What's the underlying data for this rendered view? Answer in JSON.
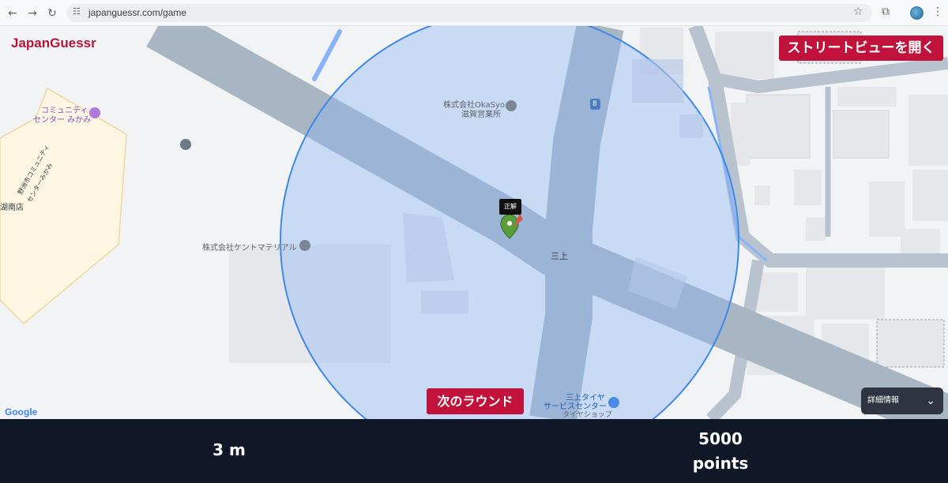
{
  "browser": {
    "url": "japanguessr.com/game",
    "icons": [
      "back-icon",
      "forward-icon",
      "reload-icon",
      "site-info-icon",
      "star-icon",
      "extensions-icon",
      "profile-avatar",
      "kebab-menu-icon"
    ]
  },
  "app": {
    "logo": "JapanGuessr",
    "streetview_button": "ストリートビューを開く",
    "next_round_button": "次のラウンド",
    "details_button": "詳細情報",
    "correct_label": "正解",
    "brand_color": "#c1123c"
  },
  "map": {
    "attribution": "Google",
    "labels": {
      "community_center_1": "コミュニティ",
      "community_center_2": "センター みかみ",
      "building_1": "野洲市コミュニティ",
      "building_2": "センターみかみ",
      "okasyo_1": "株式会社OkaSyo",
      "okasyo_2": "滋賀営業所",
      "kento": "株式会社ケントマテリアル",
      "road_number": "8",
      "area": "三上",
      "tire_1": "三上タイヤ",
      "tire_2": "サービスセンター",
      "tire_3": "タイヤショップ",
      "left_edge": "湖南店"
    }
  },
  "result": {
    "distance": "3 m",
    "score_value": "5000",
    "score_unit": "points"
  }
}
